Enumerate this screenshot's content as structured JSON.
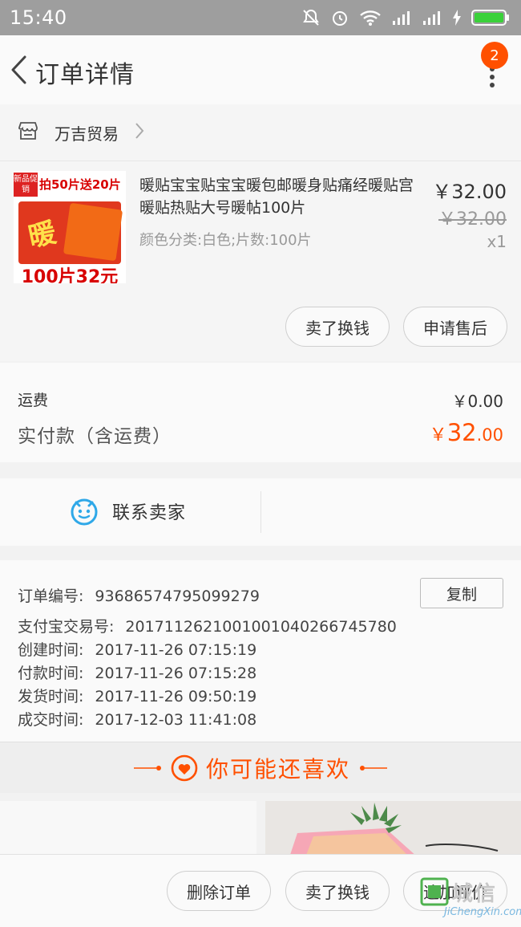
{
  "status_bar": {
    "time": "15:40",
    "icons": [
      "mute-icon",
      "alarm-icon",
      "wifi-icon",
      "signal-icon",
      "signal-icon",
      "charging-icon",
      "battery-icon"
    ]
  },
  "header": {
    "title": "订单详情",
    "badge_count": "2",
    "icons": [
      "back-icon",
      "more-icon"
    ]
  },
  "store": {
    "name": "万吉贸易",
    "icon": "store-icon"
  },
  "product": {
    "title": "暖贴宝宝贴宝宝暖包邮暖身贴痛经暖贴宫暖贴热贴大号暖帖100片",
    "spec": "颜色分类:白色;片数:100片",
    "price_now": "￥32.00",
    "price_original": "￥32.00",
    "quantity": "x1",
    "image_text": {
      "tag": "新品促销",
      "promo": "拍50片送20片",
      "bottom": "100片32元",
      "pack": "暖"
    },
    "actions": [
      "卖了换钱",
      "申请售后"
    ]
  },
  "fees": {
    "shipping_label": "运费",
    "shipping_value": "￥0.00",
    "paid_label": "实付款（含运费）",
    "paid_currency": "￥",
    "paid_integer": "32",
    "paid_decimal": ".00"
  },
  "contact": {
    "label": "联系卖家",
    "icon": "chat-face-icon"
  },
  "order_info": {
    "copy_label": "复制",
    "rows": [
      {
        "key": "订单编号:",
        "value": "93686574795099279"
      },
      {
        "key": "支付宝交易号:",
        "value": "2017112621001001040266745780"
      },
      {
        "key": "创建时间:",
        "value": "2017-11-26 07:15:19"
      },
      {
        "key": "付款时间:",
        "value": "2017-11-26 07:15:28"
      },
      {
        "key": "发货时间:",
        "value": "2017-11-26 09:50:19"
      },
      {
        "key": "成交时间:",
        "value": "2017-12-03 11:41:08"
      }
    ]
  },
  "recommend": {
    "title": "你可能还喜欢",
    "icon": "heart-icon"
  },
  "bottom_bar": {
    "buttons": [
      "删除订单",
      "卖了换钱",
      "追加评价"
    ]
  },
  "watermark": {
    "text": "城信",
    "sub": "JiChengXin.com"
  },
  "colors": {
    "accent": "#ff5000",
    "status_bar": "#9e9e9e",
    "contact_icon": "#2fa8e8"
  }
}
